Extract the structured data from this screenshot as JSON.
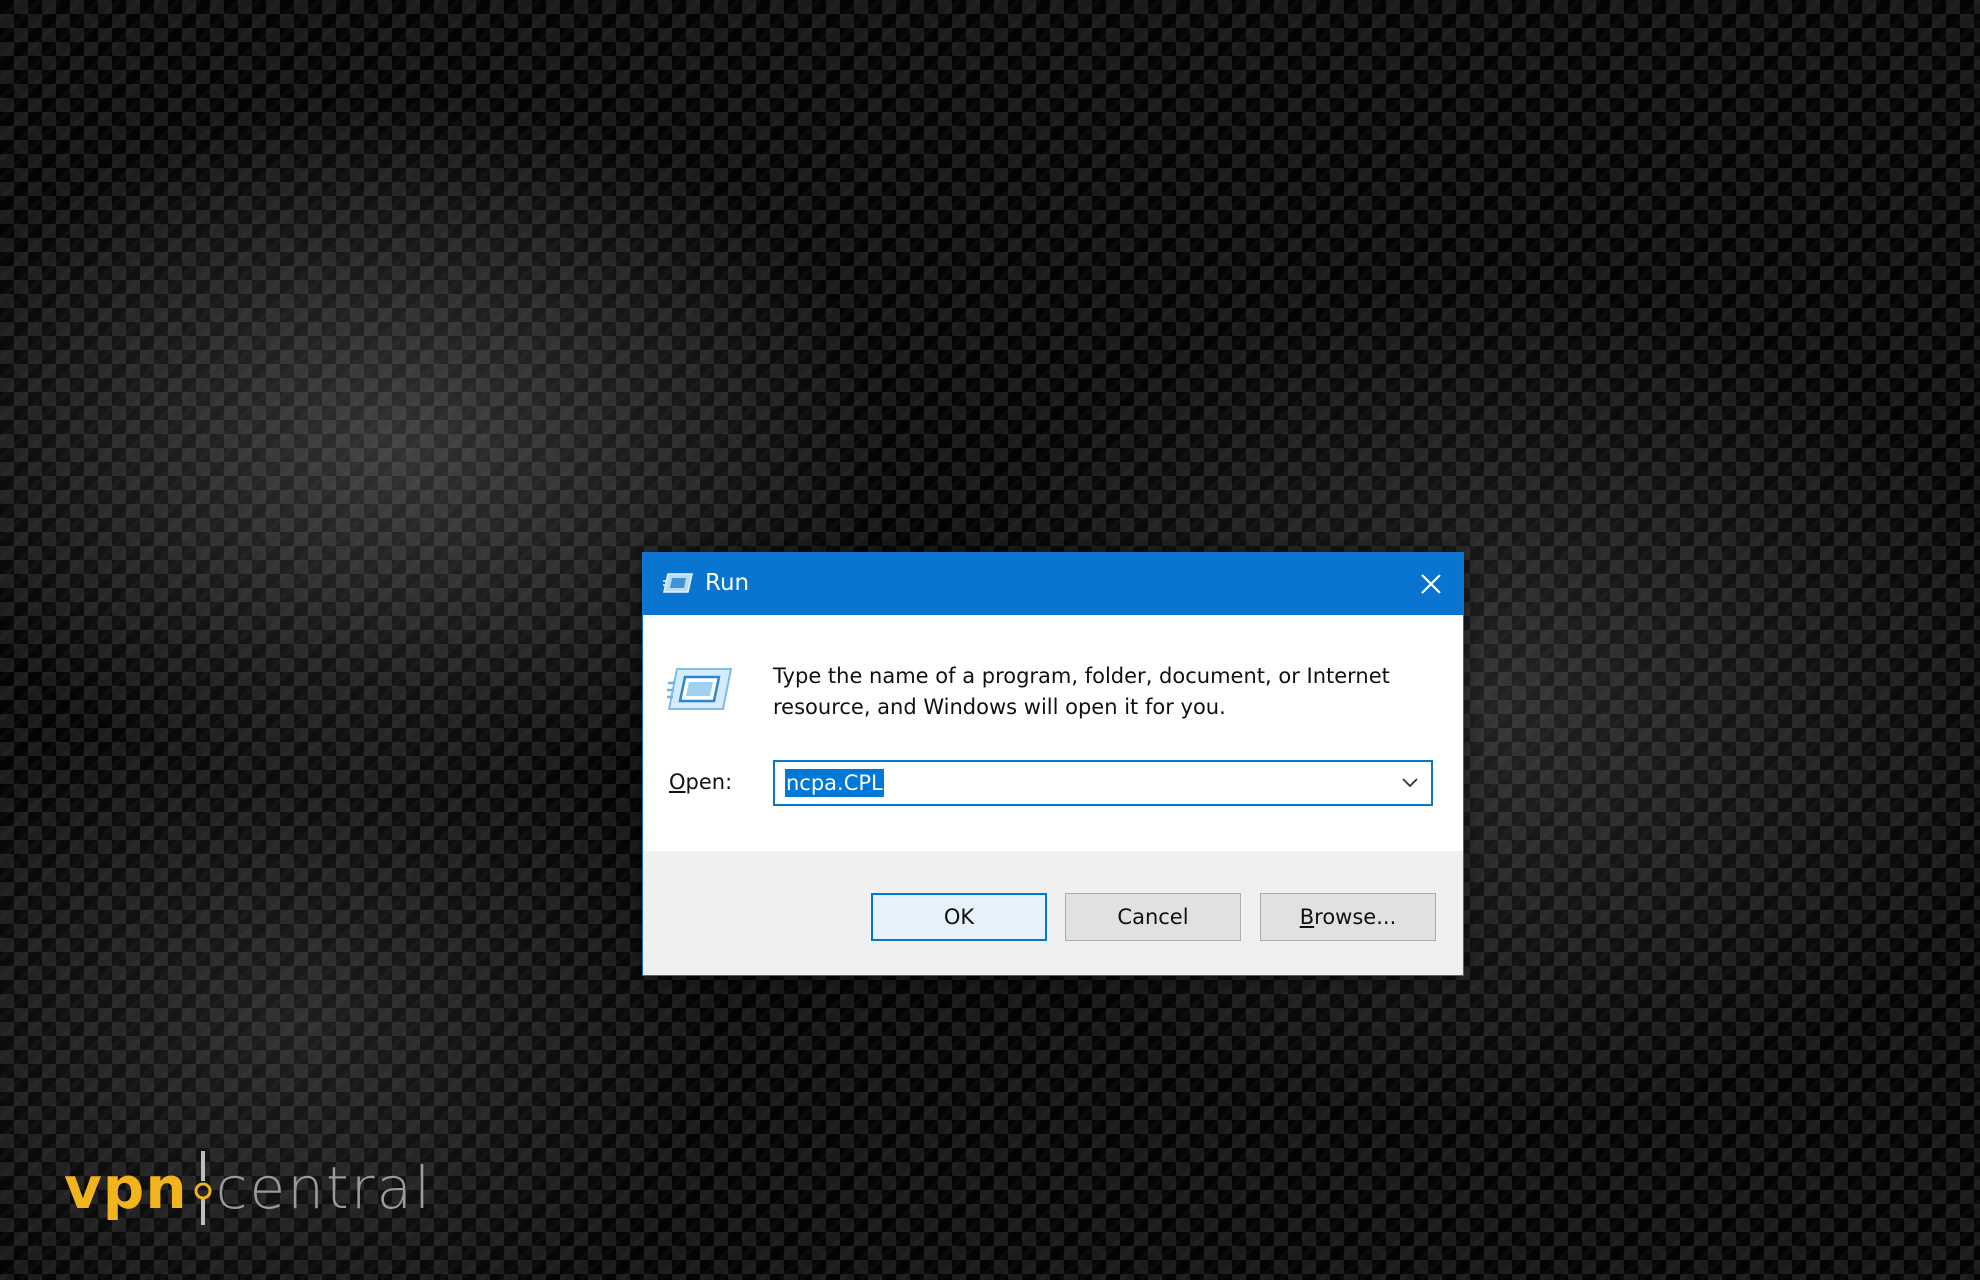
{
  "dialog": {
    "title": "Run",
    "description": "Type the name of a program, folder, document, or Internet resource, and Windows will open it for you.",
    "open_label_mnemonic": "O",
    "open_label_rest": "pen:",
    "open_value": "ncpa.CPL",
    "buttons": {
      "ok": "OK",
      "cancel": "Cancel",
      "browse_mnemonic": "B",
      "browse_rest": "rowse..."
    }
  },
  "watermark": {
    "vpn": "vpn",
    "central": "central"
  },
  "colors": {
    "titlebar": "#0a74d1",
    "selection": "#0078d7",
    "button_face": "#e1e1e1",
    "button_area": "#f0f0f0",
    "logo_accent": "#f2b41c",
    "logo_gray": "#9a9a9a"
  },
  "icons": {
    "title": "run-icon",
    "close": "close-icon",
    "dialog": "run-icon",
    "dropdown": "chevron-down-icon",
    "logo_divider": "key-icon"
  }
}
